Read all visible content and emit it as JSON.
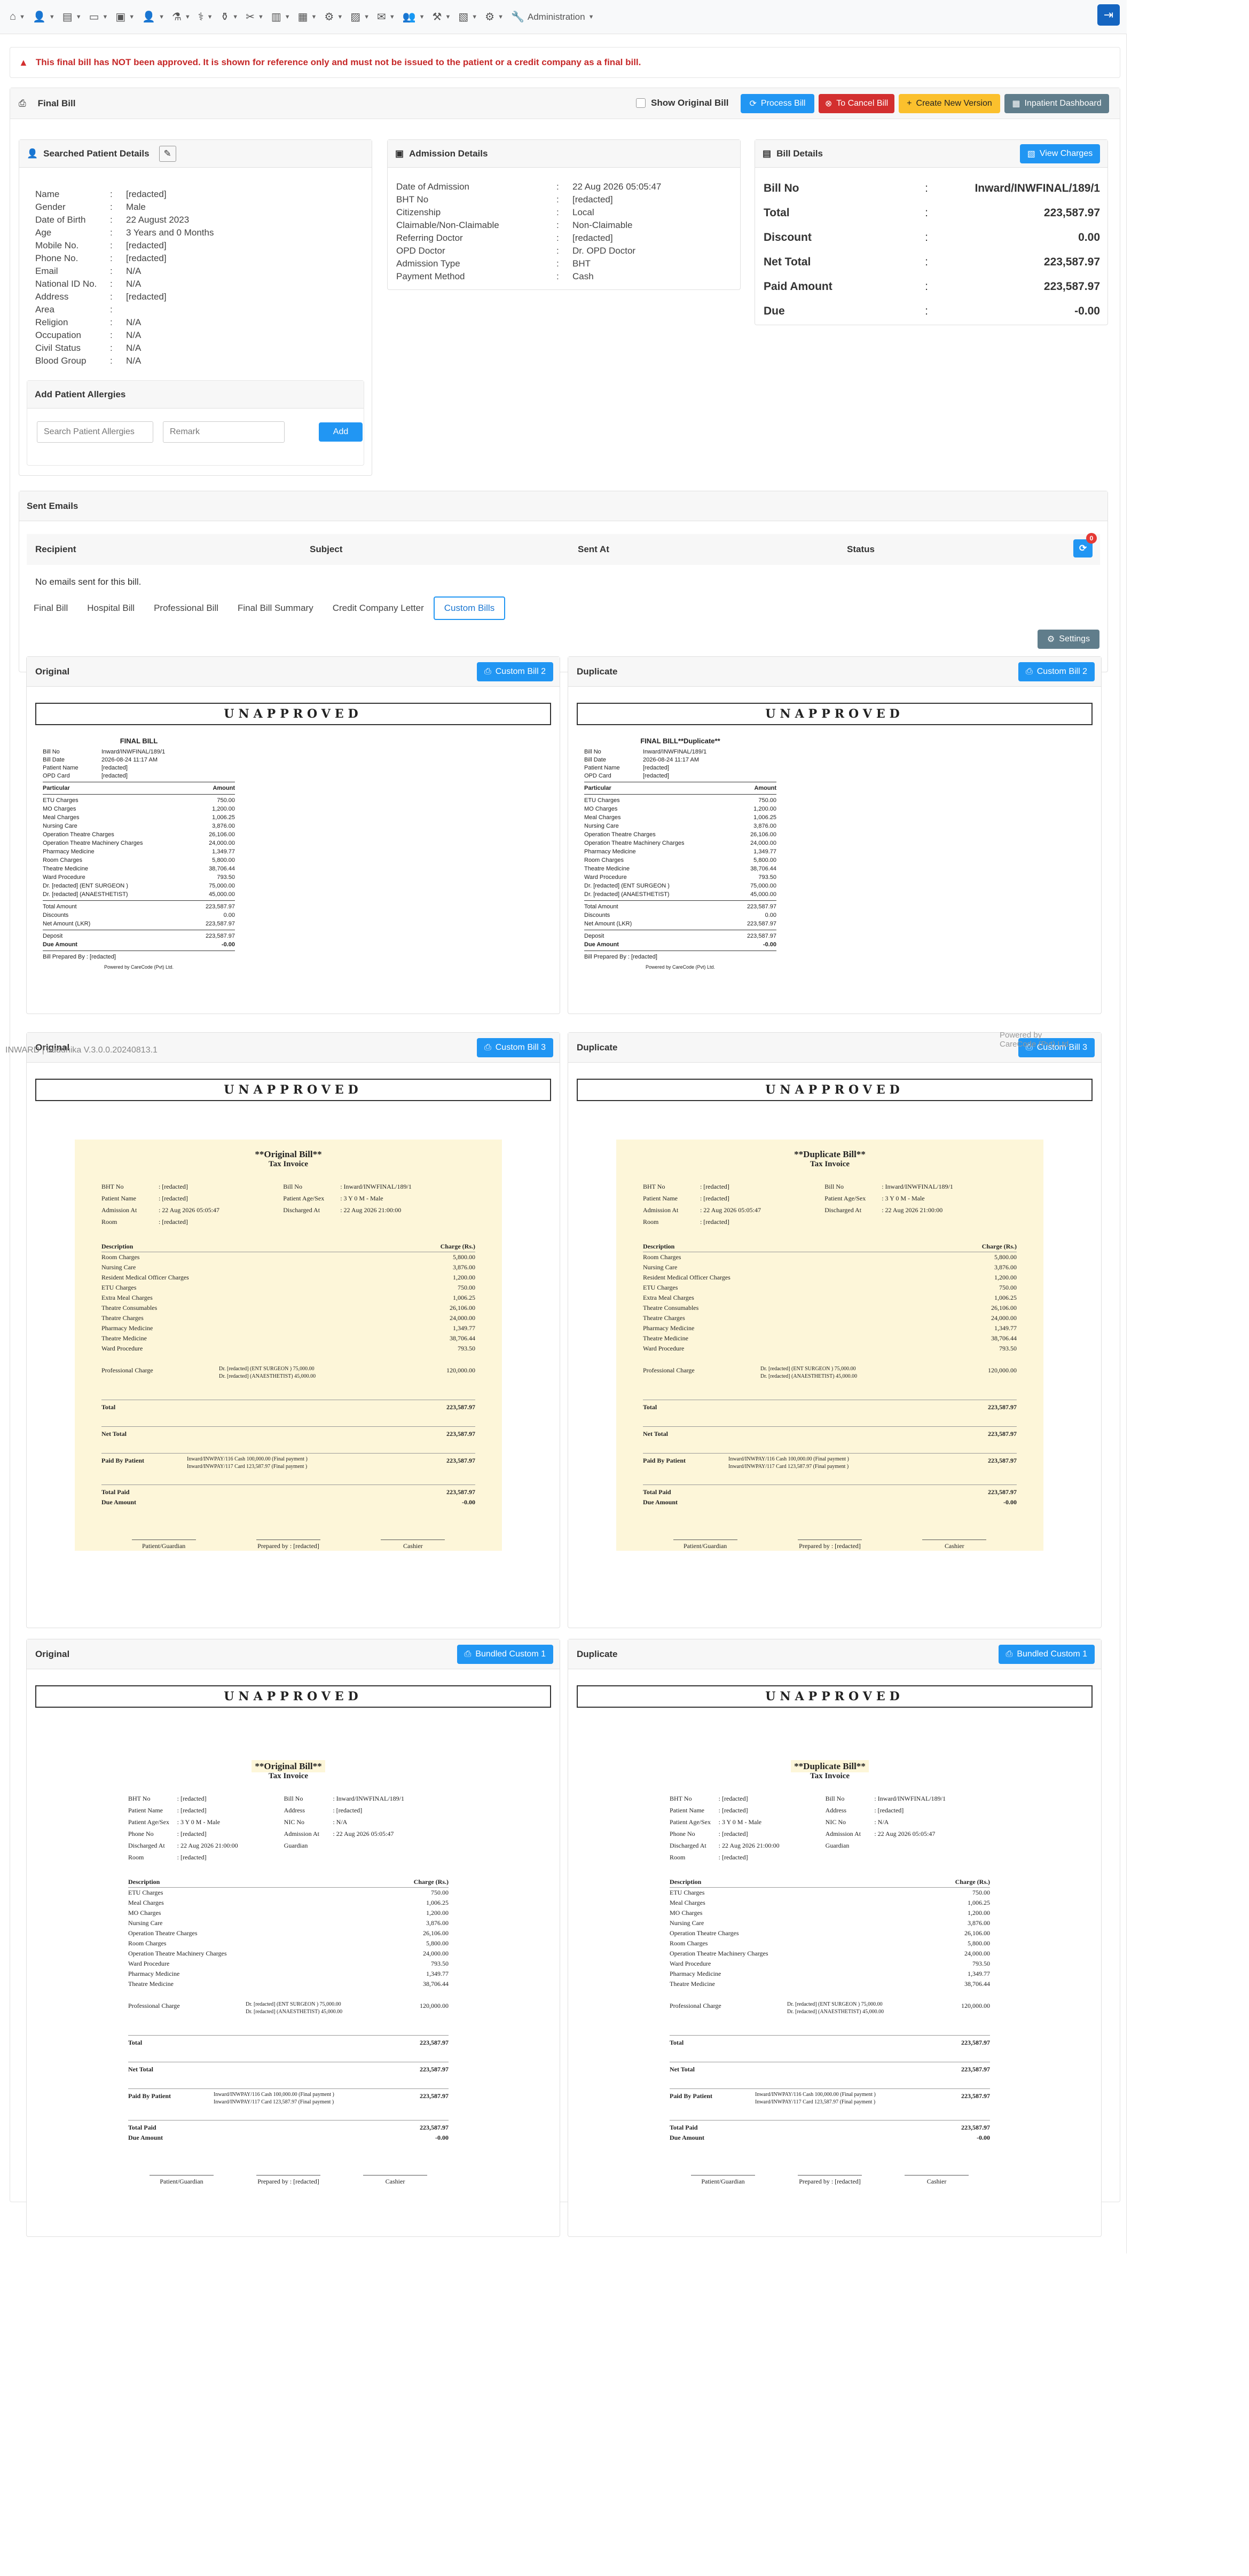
{
  "navbar": {
    "items": [
      {
        "icon": "home-icon",
        "glyph": "⌂"
      },
      {
        "icon": "user-icon",
        "glyph": "👤"
      },
      {
        "icon": "card-icon",
        "glyph": "▤"
      },
      {
        "icon": "bed-icon",
        "glyph": "▭"
      },
      {
        "icon": "inbox-icon",
        "glyph": "▣"
      },
      {
        "icon": "user-tie-icon",
        "glyph": "👤"
      },
      {
        "icon": "microscope-icon",
        "glyph": "⚗"
      },
      {
        "icon": "pharmacy-icon",
        "glyph": "⚕"
      },
      {
        "icon": "flask-icon",
        "glyph": "⚱"
      },
      {
        "icon": "tools-icon",
        "glyph": "✂"
      },
      {
        "icon": "storefront-icon",
        "glyph": "▥"
      },
      {
        "icon": "calendar-icon",
        "glyph": "▦"
      },
      {
        "icon": "settings-icon",
        "glyph": "⚙"
      },
      {
        "icon": "money-icon",
        "glyph": "▨"
      },
      {
        "icon": "mail-icon",
        "glyph": "✉"
      },
      {
        "icon": "users-icon",
        "glyph": "👥"
      },
      {
        "icon": "wrench-icon",
        "glyph": "⚒"
      },
      {
        "icon": "chart-icon",
        "glyph": "▧"
      },
      {
        "icon": "gear-icon",
        "glyph": "⚙"
      }
    ],
    "admin_label": "Administration"
  },
  "alert": {
    "text": "This final bill has NOT been approved. It is shown for reference only and must not be issued to the patient or a credit company as a final bill."
  },
  "header": {
    "title": "Final Bill",
    "show_original": "Show Original Bill",
    "process_bill": "Process Bill",
    "cancel_bill": "To Cancel Bill",
    "new_version": "Create New Version",
    "inpatient_dashboard": "Inpatient Dashboard"
  },
  "patient": {
    "title": "Searched Patient Details",
    "fields": [
      {
        "k": "Name",
        "v": "[redacted]"
      },
      {
        "k": "Gender",
        "v": "Male"
      },
      {
        "k": "Date of Birth",
        "v": "22 August 2023"
      },
      {
        "k": "Age",
        "v": "3 Years and 0 Months"
      },
      {
        "k": "Mobile No.",
        "v": "[redacted]"
      },
      {
        "k": "Phone No.",
        "v": "[redacted]"
      },
      {
        "k": "Email",
        "v": "N/A"
      },
      {
        "k": "National ID No.",
        "v": "N/A"
      },
      {
        "k": "Address",
        "v": "[redacted]"
      },
      {
        "k": "Area",
        "v": ""
      },
      {
        "k": "Religion",
        "v": "N/A"
      },
      {
        "k": "Occupation",
        "v": "N/A"
      },
      {
        "k": "Civil Status",
        "v": "N/A"
      },
      {
        "k": "Blood Group",
        "v": "N/A"
      }
    ]
  },
  "allergies": {
    "title": "Add Patient Allergies",
    "search_placeholder": "Search Patient Allergies",
    "remark_placeholder": "Remark",
    "add": "Add"
  },
  "admission": {
    "title": "Admission Details",
    "fields": [
      {
        "k": "Date of Admission",
        "v": "22 Aug 2026 05:05:47"
      },
      {
        "k": "BHT No",
        "v": "[redacted]"
      },
      {
        "k": "Citizenship",
        "v": "Local"
      },
      {
        "k": "Claimable/Non-Claimable",
        "v": "Non-Claimable"
      },
      {
        "k": "Referring Doctor",
        "v": "[redacted]"
      },
      {
        "k": "OPD Doctor",
        "v": "Dr. OPD Doctor"
      },
      {
        "k": "Admission Type",
        "v": "BHT"
      },
      {
        "k": "Payment Method",
        "v": "Cash"
      }
    ]
  },
  "bill": {
    "title": "Bill Details",
    "view_charges": "View Charges",
    "fields": [
      {
        "k": "Bill No",
        "v": "Inward/INWFINAL/189/1"
      },
      {
        "k": "Total",
        "v": "223,587.97"
      },
      {
        "k": "Discount",
        "v": "0.00"
      },
      {
        "k": "Net Total",
        "v": "223,587.97"
      },
      {
        "k": "Paid Amount",
        "v": "223,587.97"
      },
      {
        "k": "Due",
        "v": "-0.00"
      }
    ]
  },
  "emails": {
    "title": "Sent Emails",
    "cols": [
      "Recipient",
      "Subject",
      "Sent At",
      "Status"
    ],
    "empty": "No emails sent for this bill.",
    "badge": "0"
  },
  "tabs": [
    "Final Bill",
    "Hospital Bill",
    "Professional Bill",
    "Final Bill Summary",
    "Credit Company Letter",
    "Custom Bills"
  ],
  "settings": "Settings",
  "labels": {
    "original": "Original",
    "duplicate": "Duplicate",
    "unapproved": "UNAPPROVED",
    "custom2": "Custom Bill 2",
    "custom3": "Custom Bill 3",
    "bundled": "Bundled Custom 1"
  },
  "small_bill": {
    "title_o": "FINAL BILL",
    "title_d": "FINAL BILL**Duplicate**",
    "head": [
      {
        "k": "Bill No",
        "v": "Inward/INWFINAL/189/1"
      },
      {
        "k": "Bill Date",
        "v": "2026-08-24 11:17 AM"
      },
      {
        "k": "Patient Name",
        "v": "[redacted]"
      },
      {
        "k": "OPD Card",
        "v": "[redacted]"
      }
    ],
    "col_a": "Particular",
    "col_b": "Amount",
    "rows": [
      {
        "k": "ETU Charges",
        "v": "750.00"
      },
      {
        "k": "MO Charges",
        "v": "1,200.00"
      },
      {
        "k": "Meal Charges",
        "v": "1,006.25"
      },
      {
        "k": "Nursing Care",
        "v": "3,876.00"
      },
      {
        "k": "Operation Theatre Charges",
        "v": "26,106.00"
      },
      {
        "k": "Operation Theatre Machinery Charges",
        "v": "24,000.00"
      },
      {
        "k": "Pharmacy Medicine",
        "v": "1,349.77"
      },
      {
        "k": "Room Charges",
        "v": "5,800.00"
      },
      {
        "k": "Theatre Medicine",
        "v": "38,706.44"
      },
      {
        "k": "Ward Procedure",
        "v": "793.50"
      },
      {
        "k": "Dr. [redacted] (ENT SURGEON )",
        "v": "75,000.00"
      },
      {
        "k": "Dr. [redacted] (ANAESTHETIST)",
        "v": "45,000.00"
      }
    ],
    "totals": [
      {
        "k": "Total Amount",
        "v": "223,587.97"
      },
      {
        "k": "Discounts",
        "v": "0.00"
      },
      {
        "k": "Net Amount (LKR)",
        "v": "223,587.97"
      }
    ],
    "deposit": {
      "k": "Deposit",
      "v": "223,587.97"
    },
    "due": {
      "k": "Due Amount",
      "v": "-0.00"
    },
    "prepared": "Bill Prepared By : [redacted]",
    "powered": "Powered by CareCode (Pvt) Ltd."
  },
  "tax": {
    "title_o": "**Original Bill**",
    "title_d": "**Duplicate Bill**",
    "sub": "Tax Invoice",
    "head3": [
      [
        "BHT No",
        "[redacted]",
        "Bill No",
        "Inward/INWFINAL/189/1"
      ],
      [
        "Patient Name",
        "[redacted]",
        "Patient Age/Sex",
        "3 Y 0 M - Male"
      ],
      [
        "Admission At",
        "22 Aug 2026 05:05:47",
        "Discharged At",
        "22 Aug 2026 21:00:00"
      ],
      [
        "Room",
        "[redacted]",
        "",
        ""
      ]
    ],
    "head4": [
      [
        "BHT No",
        "[redacted]",
        "Bill No",
        "Inward/INWFINAL/189/1"
      ],
      [
        "Patient Name",
        "[redacted]",
        "Address",
        "[redacted]"
      ],
      [
        "Patient Age/Sex",
        "3 Y 0 M - Male",
        "NIC No",
        "N/A"
      ],
      [
        "Phone No",
        "[redacted]",
        "Admission At",
        "22 Aug 2026 05:05:47"
      ],
      [
        "Discharged At",
        "22 Aug 2026 21:00:00",
        "Guardian",
        ""
      ],
      [
        "Room",
        "[redacted]",
        "",
        ""
      ]
    ],
    "desc": "Description",
    "charge": "Charge (Rs.)",
    "rows3": [
      {
        "k": "Room Charges",
        "v": "5,800.00"
      },
      {
        "k": "Nursing Care",
        "v": "3,876.00"
      },
      {
        "k": "Resident Medical Officer Charges",
        "v": "1,200.00"
      },
      {
        "k": "ETU Charges",
        "v": "750.00"
      },
      {
        "k": "Extra Meal Charges",
        "v": "1,006.25"
      },
      {
        "k": "Theatre Consumables",
        "v": "26,106.00"
      },
      {
        "k": "Theatre Charges",
        "v": "24,000.00"
      },
      {
        "k": "Pharmacy Medicine",
        "v": "1,349.77"
      },
      {
        "k": "Theatre Medicine",
        "v": "38,706.44"
      },
      {
        "k": "Ward Procedure",
        "v": "793.50"
      }
    ],
    "rows4": [
      {
        "k": "ETU Charges",
        "v": "750.00"
      },
      {
        "k": "Meal Charges",
        "v": "1,006.25"
      },
      {
        "k": "MO Charges",
        "v": "1,200.00"
      },
      {
        "k": "Nursing Care",
        "v": "3,876.00"
      },
      {
        "k": "Operation Theatre Charges",
        "v": "26,106.00"
      },
      {
        "k": "Room Charges",
        "v": "5,800.00"
      },
      {
        "k": "Operation Theatre Machinery Charges",
        "v": "24,000.00"
      },
      {
        "k": "Ward Procedure",
        "v": "793.50"
      },
      {
        "k": "Pharmacy Medicine",
        "v": "1,349.77"
      },
      {
        "k": "Theatre Medicine",
        "v": "38,706.44"
      }
    ],
    "prof": "Professional Charge",
    "prof_lines": [
      "Dr. [redacted] (ENT SURGEON )    75,000.00",
      "Dr. [redacted] (ANAESTHETIST)    45,000.00"
    ],
    "prof_total": "120,000.00",
    "total_k": "Total",
    "total_v": "223,587.97",
    "net_k": "Net Total",
    "net_v": "223,587.97",
    "paid_k": "Paid By Patient",
    "paid_lines": [
      "Inward/INWPAY/116   Cash   100,000.00   (Final payment )",
      "Inward/INWPAY/117   Card   123,587.97   (Final payment )"
    ],
    "paid_v": "223,587.97",
    "tpaid_k": "Total Paid",
    "tpaid_v": "223,587.97",
    "due_k": "Due Amount",
    "due_v": "-0.00",
    "sigs": [
      "Patient/Guardian",
      "Prepared by : [redacted]",
      "Cashier"
    ]
  },
  "footer": {
    "version": "INWARD  |  buddhika    V.3.0.0.20240813.1",
    "powered": "Powered by",
    "company": "CareCode (Pvt) Ltd."
  }
}
